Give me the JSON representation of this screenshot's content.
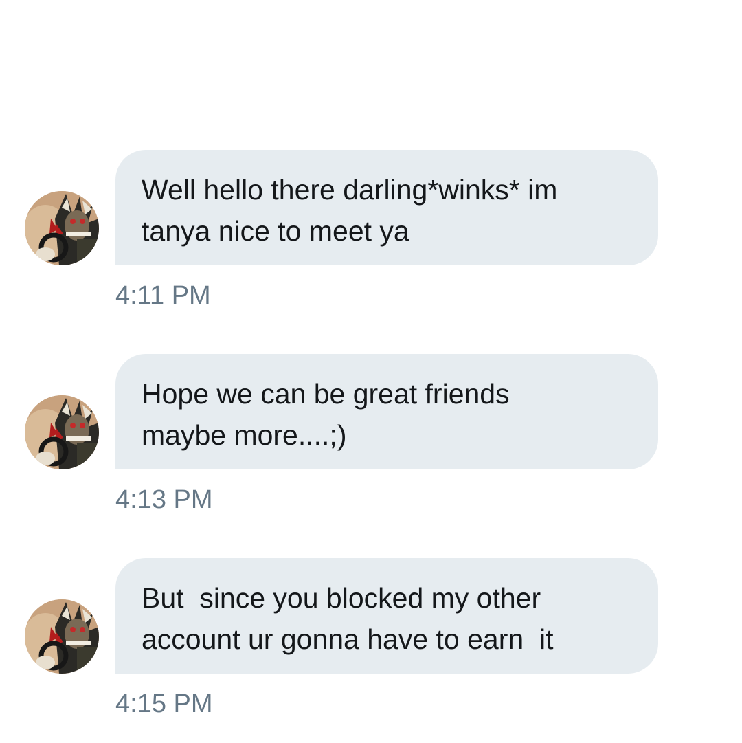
{
  "conversation": {
    "messages": [
      {
        "text": "Well hello there darling*winks* im\ntanya nice to meet ya",
        "time": "4:11 PM",
        "avatar_icon": "user-avatar-icon"
      },
      {
        "text": "Hope we can be great friends\nmaybe more....;)",
        "time": "4:13 PM",
        "avatar_icon": "user-avatar-icon"
      },
      {
        "text": "But  since you blocked my other\naccount ur gonna have to earn  it",
        "time": "4:15 PM",
        "avatar_icon": "user-avatar-icon"
      }
    ]
  },
  "colors": {
    "bubble_background": "#e6ecf0",
    "message_text": "#14171a",
    "timestamp_text": "#657786",
    "page_background": "#ffffff"
  }
}
